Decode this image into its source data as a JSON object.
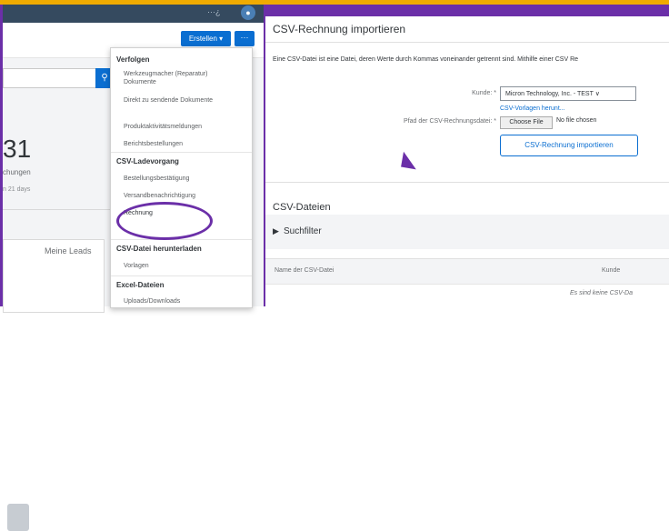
{
  "colors": {
    "purple": "#6b2fa8",
    "orange": "#f0ab00",
    "blue": "#0a6ed1",
    "shellbar": "#354a5f"
  },
  "left": {
    "top_bar_small": "···¿",
    "create_button": "Erstellen",
    "more_button": "···",
    "search_icon": "search-icon",
    "big_number": "31",
    "number_label": "chungen",
    "number_sub": "n 21 days",
    "leads_title": "Meine Leads"
  },
  "menu": {
    "sections": [
      {
        "title": "Verfolgen",
        "items": [
          "Werkzeugmacher (Reparatur) Dokumente",
          "Direkt zu sendende Dokumente",
          "Produktaktivitätsmeldungen",
          "Berichtsbestellungen"
        ]
      },
      {
        "title": "CSV-Ladevorgang",
        "items": [
          "Bestellungsbestätigung",
          "Versandbenachrichtigung",
          "Rechnung"
        ]
      },
      {
        "title": "CSV-Datei herunterladen",
        "items": [
          "Vorlagen"
        ]
      },
      {
        "title": "Excel-Dateien",
        "items": [
          "Uploads/Downloads"
        ]
      }
    ]
  },
  "right": {
    "title": "CSV-Rechnung importieren",
    "description": "Eine CSV-Datei ist eine Datei, deren Werte durch Kommas voneinander getrennt sind. Mithilfe einer CSV Re",
    "customer_label": "Kunde: *",
    "customer_value": "Micron Technology, Inc. - TEST",
    "template_link": "CSV-Vorlagen herunt...",
    "path_label": "Pfad der CSV-Rechnungsdatei: *",
    "choose_file": "Choose File",
    "no_file": "No file chosen",
    "import_button": "CSV-Rechnung importieren",
    "section_title": "CSV-Dateien",
    "filter_label": "Suchfilter",
    "col_name": "Name der CSV-Datei",
    "col_customer": "Kunde",
    "no_data": "Es sind keine CSV-Da"
  }
}
